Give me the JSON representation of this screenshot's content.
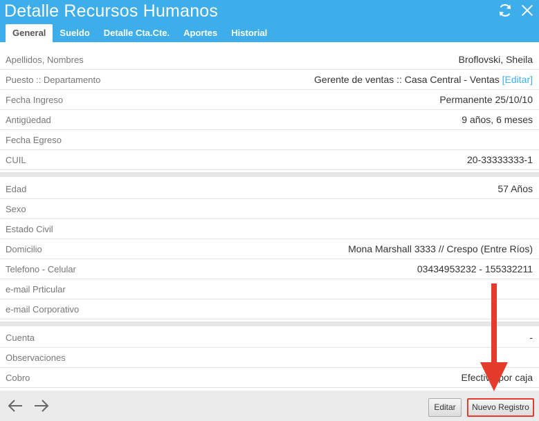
{
  "header": {
    "title": "Detalle Recursos Humanos",
    "refresh_icon": "refresh-icon",
    "close_icon": "close-icon",
    "color": "#3daee9"
  },
  "tabs": [
    {
      "label": "General",
      "active": true
    },
    {
      "label": "Sueldo",
      "active": false
    },
    {
      "label": "Detalle Cta.Cte.",
      "active": false
    },
    {
      "label": "Aportes",
      "active": false
    },
    {
      "label": "Historial",
      "active": false
    }
  ],
  "section1": [
    {
      "label": "Apellidos, Nombres",
      "value": "Broflovski, Sheila"
    },
    {
      "label": "Puesto :: Departamento",
      "value": "Gerente de ventas :: Casa Central - Ventas",
      "link": "[Editar]"
    },
    {
      "label": "Fecha Ingreso",
      "value": "Permanente 25/10/10"
    },
    {
      "label": "Antigüedad",
      "value": "9 años, 6 meses"
    },
    {
      "label": "Fecha Egreso",
      "value": ""
    },
    {
      "label": "CUIL",
      "value": "20-33333333-1"
    }
  ],
  "section2": [
    {
      "label": "Edad",
      "value": "57 Años"
    },
    {
      "label": "Sexo",
      "value": ""
    },
    {
      "label": "Estado Civil",
      "value": ""
    },
    {
      "label": "Domicilio",
      "value": "Mona Marshall 3333 // Crespo (Entre Ríos)"
    },
    {
      "label": "Telefono - Celular",
      "value": "03434953232 - 155332211"
    },
    {
      "label": "e-mail Prticular",
      "value": ""
    },
    {
      "label": "e-mail Corporativo",
      "value": ""
    }
  ],
  "section3": [
    {
      "label": "Cuenta",
      "value": "-"
    },
    {
      "label": "Observaciones",
      "value": ""
    },
    {
      "label": "Cobro",
      "value": "Efectivo por caja"
    }
  ],
  "footer": {
    "back_icon": "arrow-left-icon",
    "forward_icon": "arrow-right-icon",
    "edit_label": "Editar",
    "new_label": "Nuevo Registro",
    "highlight_color": "#e53b2c"
  }
}
